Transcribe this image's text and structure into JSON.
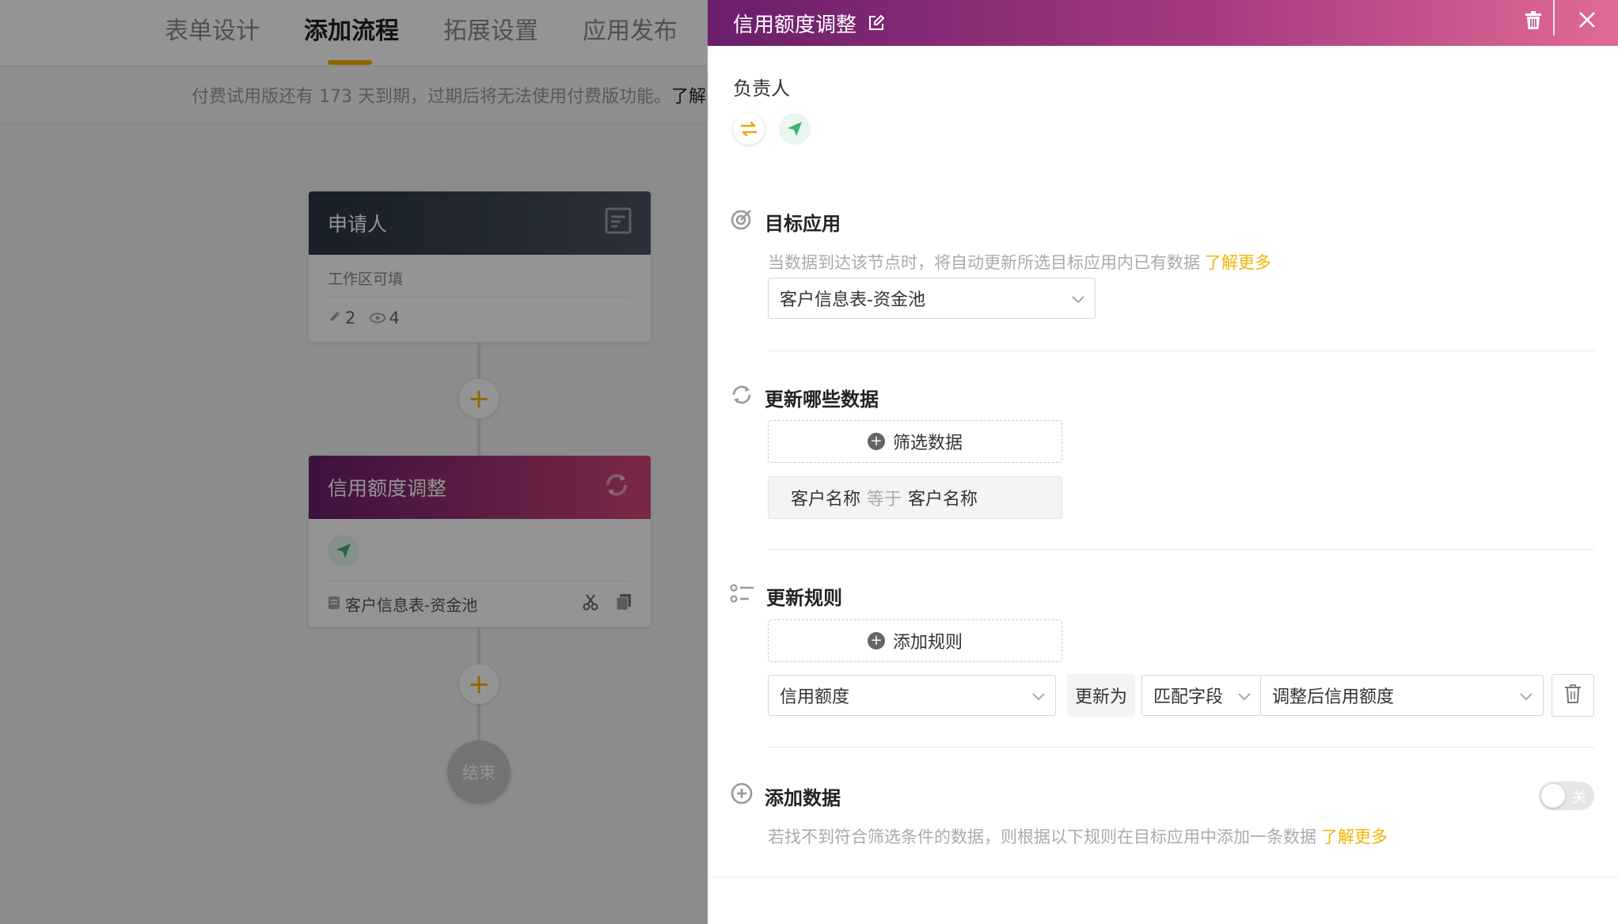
{
  "nav": {
    "tabs": [
      "表单设计",
      "添加流程",
      "拓展设置",
      "应用发布"
    ],
    "active_tab": "添加流程"
  },
  "trial": {
    "text": "付费试用版还有 173 天到期，过期后将无法使用付费版功能。",
    "more": "了解"
  },
  "flow": {
    "node_applicant": {
      "title": "申请人",
      "subtitle": "工作区可填",
      "edit_count": "2",
      "view_count": "4"
    },
    "node_update": {
      "title": "信用额度调整",
      "target": "客户信息表-资金池"
    },
    "end_label": "结束"
  },
  "drawer": {
    "title": "信用额度调整",
    "owner_label": "负责人",
    "target_app": {
      "title": "目标应用",
      "desc": "当数据到达该节点时，将自动更新所选目标应用内已有数据",
      "link": "了解更多",
      "selected": "客户信息表-资金池"
    },
    "which_data": {
      "title": "更新哪些数据",
      "filter_button": "筛选数据",
      "filter": {
        "field": "客户名称",
        "op": "等于",
        "value": "客户名称"
      }
    },
    "rules": {
      "title": "更新规则",
      "add_button": "添加规则",
      "rule": {
        "field": "信用额度",
        "update_to": "更新为",
        "mode": "匹配字段",
        "value": "调整后信用额度"
      }
    },
    "add_data": {
      "title": "添加数据",
      "desc": "若找不到符合筛选条件的数据，则根据以下规则在目标应用中添加一条数据",
      "link": "了解更多",
      "toggle_label": "关"
    }
  },
  "colors": {
    "accent": "#f0b400",
    "header_start": "#6a1e6a",
    "header_end": "#e06a95",
    "send_green": "#3cb371"
  }
}
